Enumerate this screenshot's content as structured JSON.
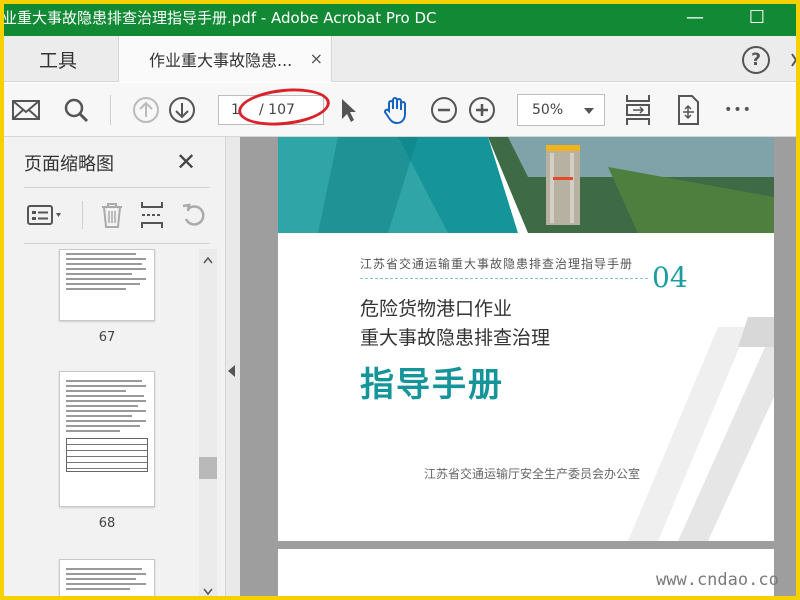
{
  "window": {
    "title": "业重大事故隐患排查治理指导手册.pdf - Adobe Acrobat Pro DC",
    "controls": {
      "minimize": "—",
      "maximize": "☐"
    }
  },
  "tabs": {
    "tools_label": "工具",
    "doc_label": "作业重大事故隐患...",
    "close_glyph": "×",
    "help_glyph": "?"
  },
  "toolbar": {
    "icons": [
      "mail-icon",
      "search-icon",
      "prev-page-icon",
      "next-page-icon",
      "select-cursor-icon",
      "hand-tool-icon",
      "zoom-out-icon",
      "zoom-in-icon",
      "fit-page-icon",
      "rotate-view-icon",
      "more-icon"
    ],
    "current_page": "1",
    "total_pages": "/ 107",
    "zoom": "50%",
    "more_glyph": "•••"
  },
  "thumbnails_panel": {
    "title": "页面缩略图",
    "close_glyph": "✕",
    "pages": [
      "67",
      "68"
    ]
  },
  "document": {
    "header": "江苏省交通运输重大事故隐患排查治理指导手册",
    "chapter": "04",
    "line1": "危险货物港口作业",
    "line2": "重大事故隐患排查治理",
    "big_title": "指导手册",
    "office": "江苏省交通运输厅安全生产委员会办公室",
    "colors": {
      "teal": "#15959a",
      "teal_light": "#7fc4c6"
    }
  },
  "watermark": {
    "bottom": "www.cndao.co"
  }
}
